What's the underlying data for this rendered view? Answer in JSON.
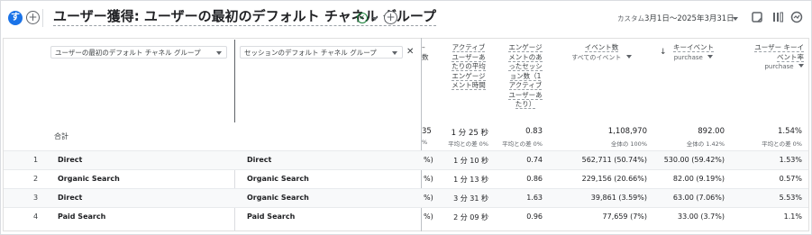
{
  "header": {
    "avatar_letter": "す",
    "add_label": "+",
    "title": "ユーザー獲得: ユーザーの最初のデフォルト チャネル グループ",
    "add_comparison_label": "+",
    "date_prefix": "カスタム",
    "date_range": "3月1日～2025年3月31日"
  },
  "table": {
    "dimension1_label": "ユーザーの最初のデフォルト チャネル グループ",
    "dimension2_label": "セッションのデフォルト チャネル グループ",
    "cut_header_fragment": "数",
    "columns": [
      {
        "lines": [
          "アクティブ",
          "ユーザーあ",
          "たりの平均",
          "エンゲージ",
          "メント時間"
        ]
      },
      {
        "lines": [
          "エンゲージ",
          "メントのあ",
          "ったセッシ",
          "ョン数（1",
          "アクティブ",
          "ユーザーあ",
          "たり）"
        ]
      },
      {
        "lines": [
          "イベント数"
        ],
        "sub": "すべてのイベント"
      },
      {
        "lines": [
          "キーイベント"
        ],
        "sub": "purchase"
      },
      {
        "lines": [
          "ユーザー キーイ",
          "ベント率"
        ],
        "sub": "purchase"
      }
    ],
    "total_label": "合計",
    "totals": {
      "cut_value": "35",
      "cut_sub": "%",
      "avg_time": "1 分 25 秒",
      "avg_time_sub": "平均との差 0%",
      "engaged": "0.83",
      "engaged_sub": "平均との差 0%",
      "events": "1,108,970",
      "events_sub": "全体の 100%",
      "key_events": "892.00",
      "key_events_sub": "全体の 1.42%",
      "rate": "1.54%",
      "rate_sub": "平均との差 0%"
    },
    "rows": [
      {
        "num": "1",
        "dim1": "Direct",
        "dim2": "Direct",
        "cut": "%)",
        "avg_time": "1 分 10 秒",
        "engaged": "0.74",
        "events": "562,711 (50.74%)",
        "key_events": "530.00 (59.42%)",
        "rate": "1.53%"
      },
      {
        "num": "2",
        "dim1": "Organic Search",
        "dim2": "Organic Search",
        "cut": "%)",
        "avg_time": "1 分 13 秒",
        "engaged": "0.86",
        "events": "229,156 (20.66%)",
        "key_events": "82.00 (9.19%)",
        "rate": "0.57%"
      },
      {
        "num": "3",
        "dim1": "Direct",
        "dim2": "Organic Search",
        "cut": "%)",
        "avg_time": "3 分 31 秒",
        "engaged": "1.63",
        "events": "39,861 (3.59%)",
        "key_events": "63.00 (7.06%)",
        "rate": "5.53%"
      },
      {
        "num": "4",
        "dim1": "Paid Search",
        "dim2": "Paid Search",
        "cut": "%)",
        "avg_time": "2 分 09 秒",
        "engaged": "0.96",
        "events": "77,659 (7%)",
        "key_events": "33.00 (3.7%)",
        "rate": "1.1%"
      }
    ]
  }
}
